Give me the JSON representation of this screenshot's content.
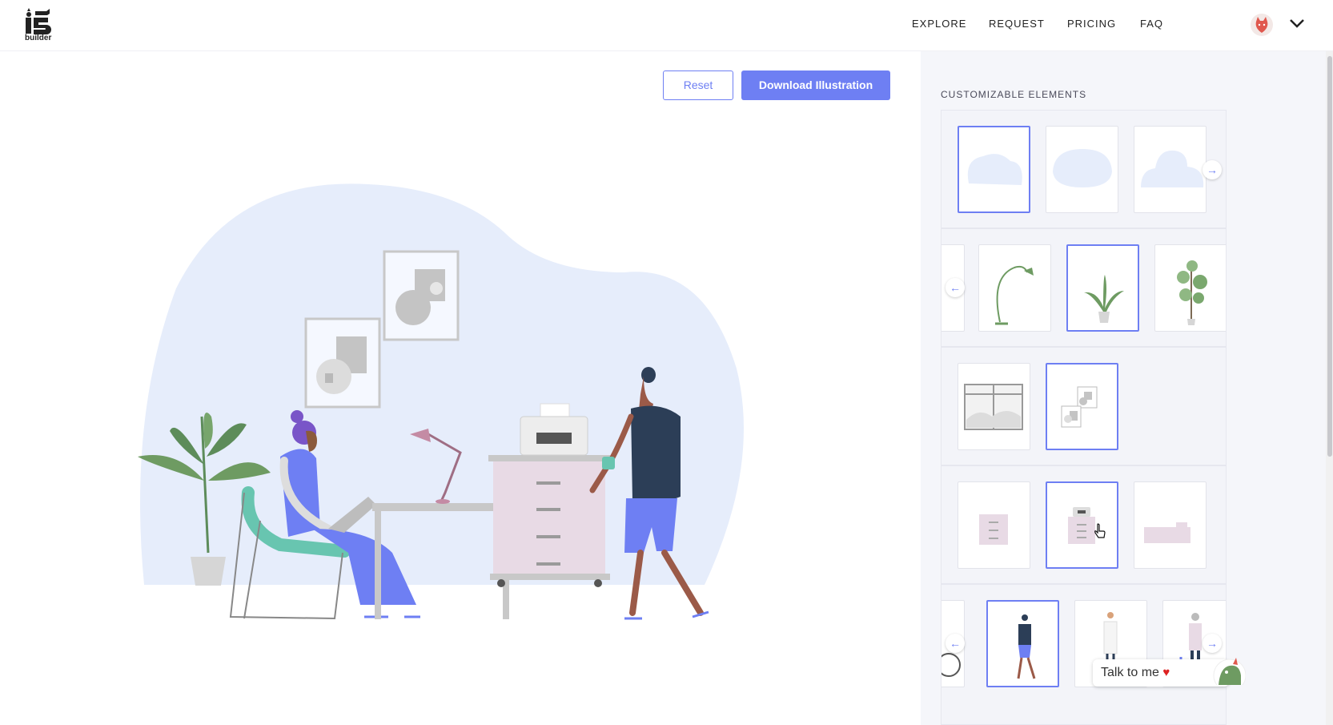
{
  "header": {
    "logo_text": "builder",
    "nav": [
      "EXPLORE",
      "REQUEST",
      "PRICING",
      "FAQ"
    ]
  },
  "toolbar": {
    "reset_label": "Reset",
    "download_label": "Download Illustration"
  },
  "panel": {
    "title": "CUSTOMIZABLE ELEMENTS"
  },
  "chat": {
    "label": "Talk to me"
  },
  "colors": {
    "accent": "#6e7ff3",
    "blob": "#e6edfb"
  },
  "icons": [
    "user-avatar-icon",
    "chevron-down-icon",
    "arrow-right-icon",
    "arrow-left-icon",
    "heart-icon",
    "mouse-pointer-icon"
  ]
}
